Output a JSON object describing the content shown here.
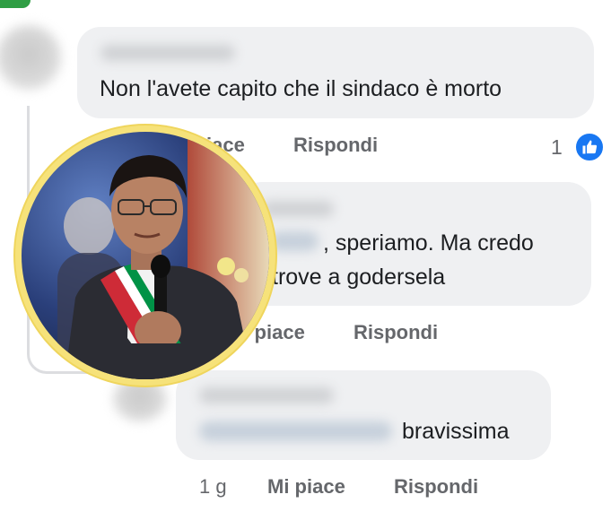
{
  "comments": [
    {
      "text": "Non l'avete capito che il sindaco è morto",
      "actions": {
        "like": "Mi piace",
        "reply": "Rispondi"
      },
      "reactions": {
        "count": "1",
        "icon": "thumbs-up-icon"
      }
    },
    {
      "text_line1": ", speriamo. Ma credo",
      "text_line2": "trove a godersela",
      "actions": {
        "like": "Mi piace",
        "reply": "Rispondi"
      }
    },
    {
      "text": "bravissima",
      "time": "1 g",
      "actions": {
        "like": "Mi piace",
        "reply": "Rispondi"
      }
    }
  ],
  "overlay_photo": {
    "description_icon": "mayor-portrait",
    "frame_color": "#f6e27a",
    "sash_colors": [
      "#009246",
      "#ffffff",
      "#ce2b37"
    ]
  },
  "colors": {
    "bubble": "#eff0f2",
    "action_text": "#65676b",
    "like_blue": "#1877f2",
    "accent_green": "#2f9e44"
  }
}
